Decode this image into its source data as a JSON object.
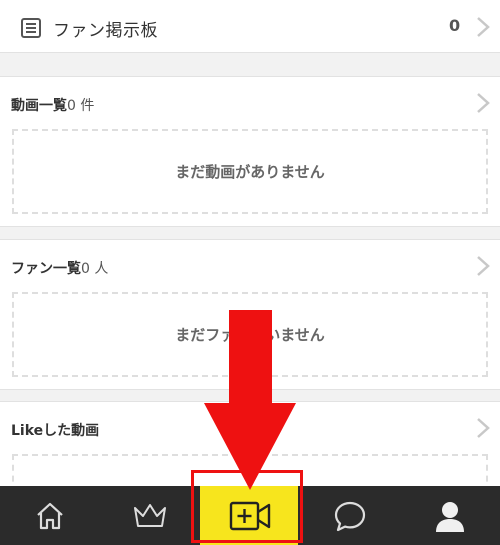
{
  "fan_board": {
    "title": "ファン掲示板",
    "count": "0"
  },
  "sections": {
    "videos": {
      "title": "動画一覧",
      "count": "0 件",
      "empty_message": "まだ動画がありません"
    },
    "fans": {
      "title": "ファン一覧",
      "count": "0 人",
      "empty_message": "まだファンがいません"
    },
    "liked": {
      "title": "Likeした動画"
    }
  },
  "bottom_nav": {
    "items": [
      {
        "icon": "home-icon"
      },
      {
        "icon": "crown-icon"
      },
      {
        "icon": "video-add-icon"
      },
      {
        "icon": "chat-bubble-icon"
      },
      {
        "icon": "user-icon"
      }
    ],
    "active_bg": "#f7e51d",
    "bar_bg": "#2b2b2b"
  },
  "annotation": {
    "color": "#ee1111"
  }
}
